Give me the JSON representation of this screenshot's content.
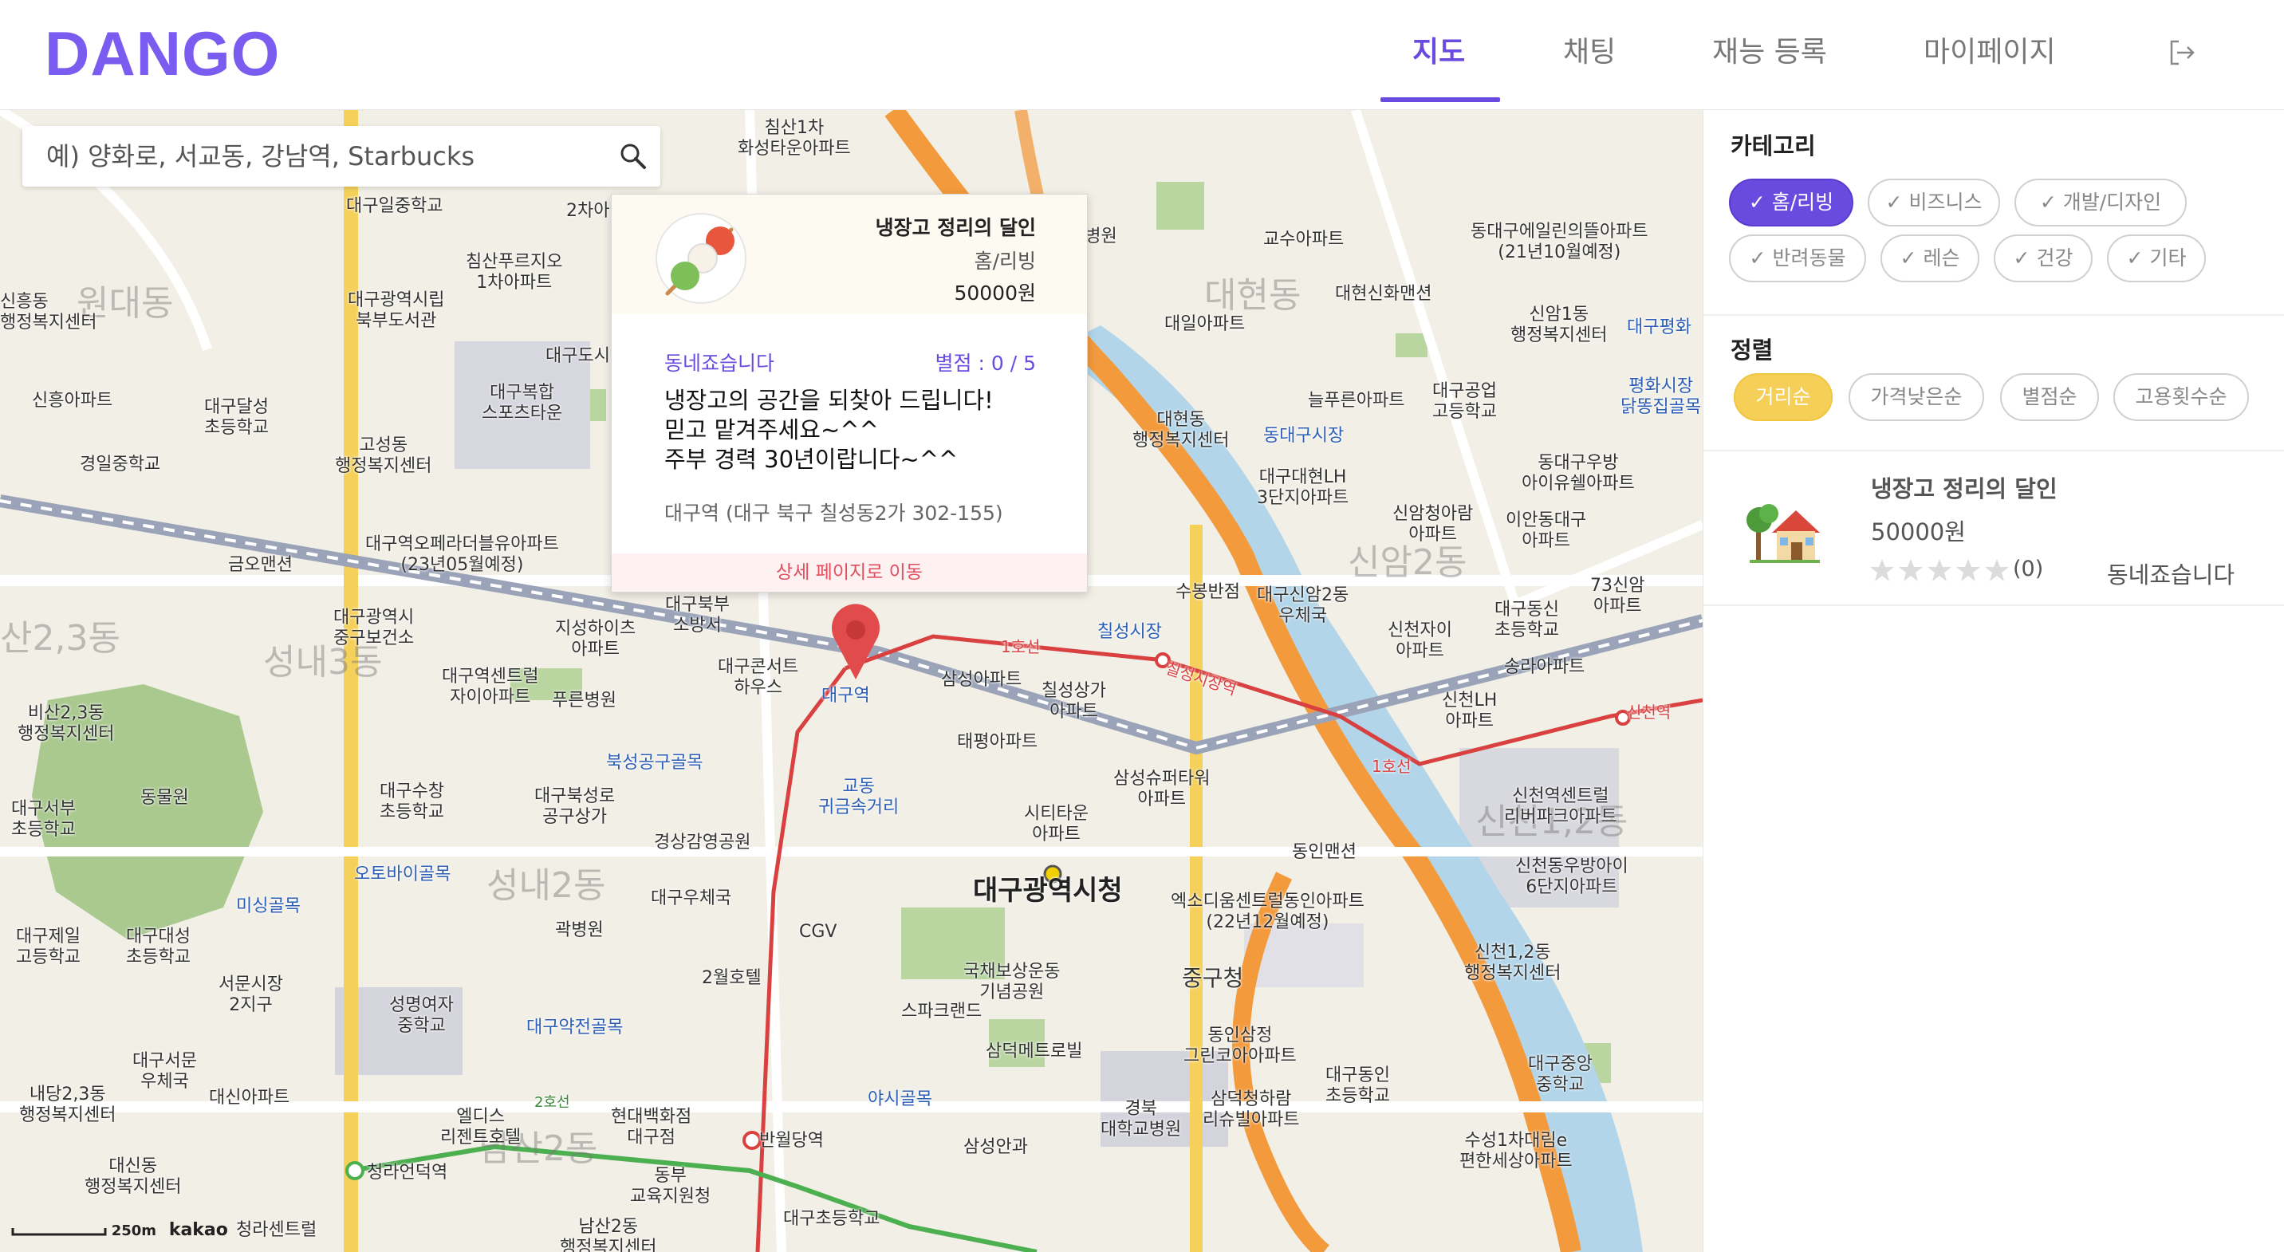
{
  "app": {
    "logo": "DANGO"
  },
  "nav": {
    "items": [
      {
        "label": "지도",
        "active": true
      },
      {
        "label": "채팅"
      },
      {
        "label": "재능 등록"
      },
      {
        "label": "마이페이지"
      }
    ],
    "logout_icon": "logout-icon"
  },
  "search": {
    "placeholder": "예) 양화로, 서교동, 강남역, Starbucks",
    "icon": "search-icon"
  },
  "popup": {
    "title": "냉장고 정리의 달인",
    "category": "홈/리빙",
    "price": "50000원",
    "seller": "동네죠습니다",
    "rating": "별점 : 0 / 5",
    "description": [
      "냉장고의 공간을 되찾아 드립니다!",
      "믿고 맡겨주세요~^^",
      "주부 경력 30년이랍니다~^^"
    ],
    "address": "대구역 (대구 북구 칠성동2가 302-155)",
    "detail_link": "상세 페이지로 이동"
  },
  "map": {
    "scale": "250m",
    "provider": "kakao",
    "labels": {
      "daegu_station": "대구역",
      "city_hall": "대구광역시청",
      "chilseong_market": "칠성시장역",
      "sincheon": "신천역",
      "banwoldang": "반월당역",
      "cheongna": "청라언덕역",
      "line1a": "1호선",
      "line1b": "1호선",
      "line2": "2호선",
      "d1": "원대동",
      "d2": "대현동",
      "d3": "신암2동",
      "d4": "성내3동",
      "d5": "성내2동",
      "d6": "신천1,2동",
      "d7": "남산2동",
      "d8": "산2,3동",
      "p1": "침산1차\n화성타운아파트",
      "p2": "대구일중학교",
      "p3": "침산푸르지오\n1차아파트",
      "p4": "대구광역시립\n북부도서관",
      "p5": "대구달성\n초등학교",
      "p6": "신흥아파트",
      "p7": "경일중학교",
      "p8": "고성동\n행정복지센터",
      "p9": "대구복합\n스포츠타운",
      "p10": "대구역오페라더블유아파트\n(23년05월예정)",
      "p11": "금오맨션",
      "p12": "대구광역시\n중구보건소",
      "p13": "지성하이츠\n아파트",
      "p14": "대구북부\n소방서",
      "p15": "대구콘서트\n하우스",
      "p16": "대구역센트럴\n자이아파트",
      "p17": "푸른병원",
      "p18": "비산2,3동\n행정복지센터",
      "p19": "동물원",
      "p20": "대구서부\n초등학교",
      "p21": "대구수창\n초등학교",
      "p22": "대구북성로\n공구상가",
      "p23": "북성공구골목",
      "p24": "경상감영공원",
      "p25": "대구우체국",
      "p26": "오토바이골목",
      "p27": "미싱골목",
      "p28": "대구제일\n고등학교",
      "p29": "대구대성\n초등학교",
      "p30": "곽병원",
      "p31": "CGV",
      "p32": "2월호텔",
      "p33": "대구약전골목",
      "p34": "서문시장\n2지구",
      "p35": "성명여자\n중학교",
      "p36": "대구서문\n우체국",
      "p37": "대신아파트",
      "p38": "내당2,3동\n행정복지센터",
      "p39": "대신동\n행정복지센터",
      "p40": "엘디스\n리젠트호텔",
      "p41": "현대백화점\n대구점",
      "p42": "동부\n교육지원청",
      "p43": "남산2동\n행정복지센터",
      "p44": "대구초등학교",
      "p45": "청라센트럴",
      "p46": "삼성아파트",
      "p47": "칠성상가\n아파트",
      "p48": "태평아파트",
      "p49": "교동\n귀금속거리",
      "p50": "시티타운\n아파트",
      "p51": "삼성슈퍼타워\n아파트",
      "p52": "국채보상운동\n기념공원",
      "p53": "스파크랜드",
      "p54": "삼덕메트로빌",
      "p55": "야시골목",
      "p56": "삼성안과",
      "p57": "경북\n대학교병원",
      "p58": "삼덕청하람\n리슈빌아파트",
      "p59": "중구청",
      "p60": "동인삼정\n그린코아아파트",
      "p61": "엑소디움센트럴동인아파트\n(22년12월예정)",
      "p62": "동인맨션",
      "p63": "대구동인\n초등학교",
      "p64": "대구중앙\n중학교",
      "p65": "수성1차대림e\n편한세상아파트",
      "p66": "신천1,2동\n행정복지센터",
      "p67": "신천역센트럴\n리버파크아파트",
      "p68": "신천동우방아이\n6단지아파트",
      "p69": "신천LH\n아파트",
      "p70": "송라아파트",
      "p71": "대구동신\n초등학교",
      "p72": "73신암\n아파트",
      "p73": "신천자이\n아파트",
      "p74": "대구신암2동\n우체국",
      "p75": "수봉반점",
      "p76": "신암청아람\n아파트",
      "p77": "이안동대구\n아파트",
      "p78": "동대구우방\n아이유쉘아파트",
      "p79": "평화시장\n닭똥집골목",
      "p80": "대구공업\n고등학교",
      "p81": "늘푸른아파트",
      "p82": "동대구시장",
      "p83": "대구대현LH\n3단지아파트",
      "p84": "대현동\n행정복지센터",
      "p85": "대일아파트",
      "p86": "교수아파트",
      "p87": "대현신화맨션",
      "p88": "동대구에일린의뜰아파트\n(21년10월예정)",
      "p89": "신암1동\n행정복지센터",
      "p90": "칠성시장",
      "p91": "대구도시",
      "p92": "2차아",
      "p93": "대구평화",
      "p94": "신흥동\n행정복지센터",
      "p95": "대구역",
      "p96": "양병원"
    }
  },
  "panel": {
    "category_title": "카테고리",
    "categories": [
      {
        "label": "✓ 홈/리빙",
        "active": true
      },
      {
        "label": "✓ 비즈니스"
      },
      {
        "label": "✓ 개발/디자인"
      },
      {
        "label": "✓ 반려동물"
      },
      {
        "label": "✓ 레슨"
      },
      {
        "label": "✓ 건강"
      },
      {
        "label": "✓ 기타"
      }
    ],
    "sort_title": "정렬",
    "sorts": [
      {
        "label": "거리순",
        "active": true
      },
      {
        "label": "가격낮은순"
      },
      {
        "label": "별점순"
      },
      {
        "label": "고용횟수순"
      }
    ],
    "items": [
      {
        "title": "냉장고 정리의 달인",
        "price": "50000원",
        "rating": 0,
        "review_count": "(0)",
        "seller": "동네죠습니다",
        "icon": "house-with-tree-icon"
      }
    ]
  },
  "colors": {
    "brand": "#7b5cf0",
    "accent": "#6a4be0",
    "sort_active": "#f5cf57",
    "link": "#e05060"
  }
}
